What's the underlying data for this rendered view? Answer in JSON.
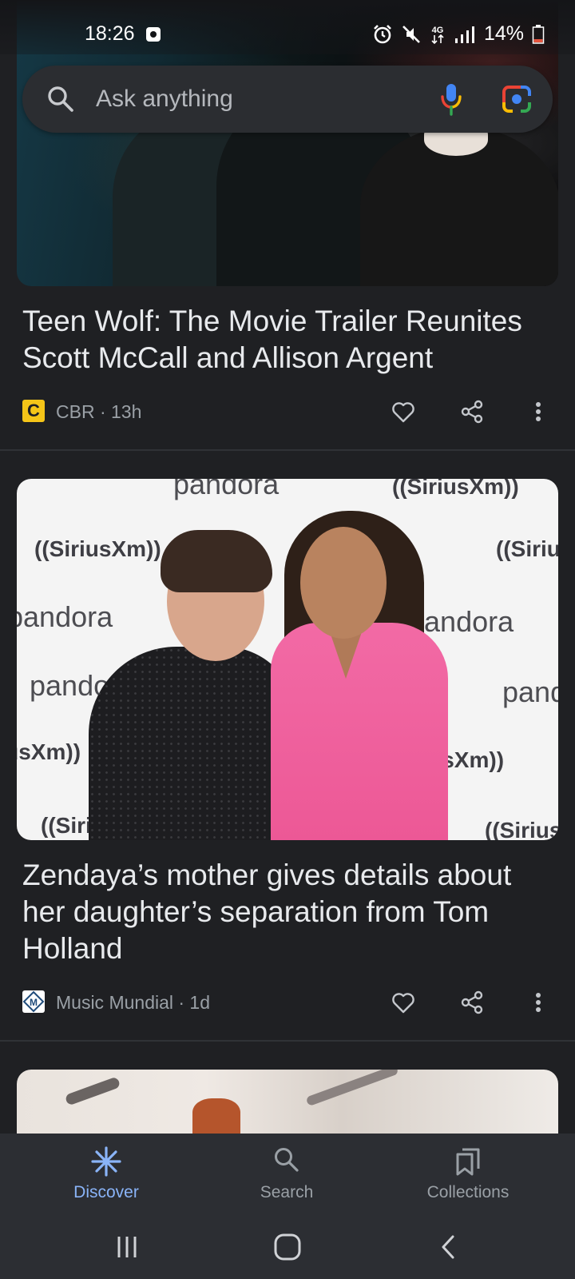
{
  "status_bar": {
    "time": "18:26",
    "network": "4G",
    "battery": "14%"
  },
  "search": {
    "placeholder": "Ask anything"
  },
  "feed": [
    {
      "title": "Teen Wolf: The Movie Trailer Reunites Scott McCall and Allison Argent",
      "source_initial": "C",
      "source": "CBR · 13h"
    },
    {
      "title": "Zendaya’s mother gives details about her daughter’s separation from Tom Holland",
      "source_initial": "M",
      "source": "Music Mundial · 1d",
      "backdrop_brands": [
        "pandora",
        "SiriusXm"
      ]
    }
  ],
  "bottom_nav": {
    "items": [
      {
        "label": "Discover",
        "icon": "discover-icon",
        "active": true
      },
      {
        "label": "Search",
        "icon": "search-icon",
        "active": false
      },
      {
        "label": "Collections",
        "icon": "collections-icon",
        "active": false
      }
    ]
  },
  "colors": {
    "background": "#1f2023",
    "nav_background": "#2c2e33",
    "accent": "#8ab4f8",
    "text_primary": "#e8eaed",
    "text_secondary": "#9aa0a6"
  }
}
